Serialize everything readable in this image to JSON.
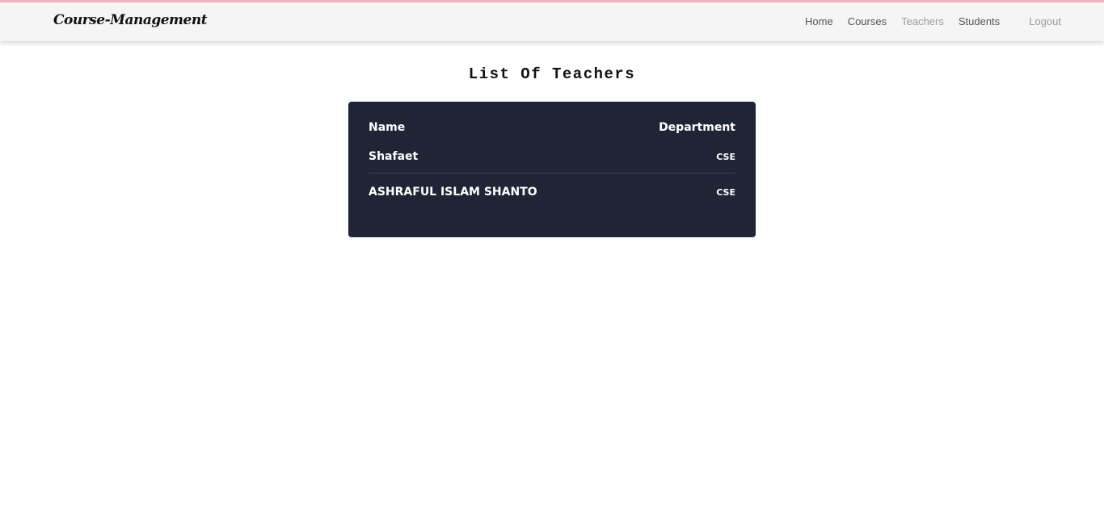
{
  "navbar": {
    "brand": "Course-Management",
    "links": [
      "Home",
      "Courses",
      "Teachers",
      "Students"
    ],
    "logout": "Logout"
  },
  "main": {
    "title": "List Of Teachers",
    "table": {
      "headers": [
        "Name",
        "Department"
      ],
      "rows": [
        {
          "name": "Shafaet",
          "department": "CSE"
        },
        {
          "name": "ASHRAFUL ISLAM SHANTO",
          "department": "CSE"
        }
      ]
    }
  },
  "colors": {
    "accent_line": "#f3b9c4",
    "navbar_bg": "#f5f5f5",
    "card_bg": "#202536",
    "active_link": "#9a9a9a"
  }
}
